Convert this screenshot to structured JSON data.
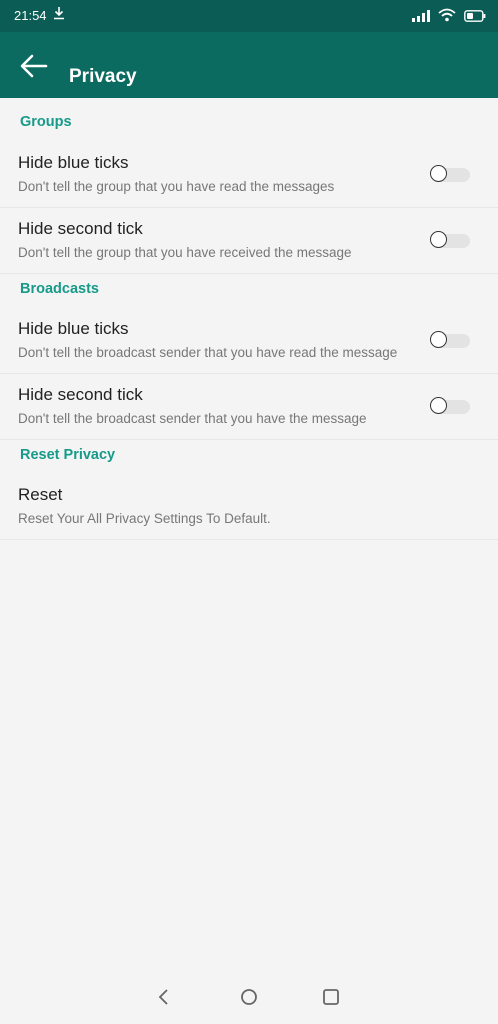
{
  "status": {
    "time": "21:54"
  },
  "appbar": {
    "title": "Privacy"
  },
  "sections": [
    {
      "header": "Groups",
      "items": [
        {
          "title": "Hide blue ticks",
          "subtitle": "Don't tell the group that you have read the messages",
          "toggle_on": false
        },
        {
          "title": "Hide second tick",
          "subtitle": "Don't tell the group that you have received the message",
          "toggle_on": false
        }
      ]
    },
    {
      "header": "Broadcasts",
      "items": [
        {
          "title": "Hide blue ticks",
          "subtitle": "Don't tell the broadcast sender that you have read the message",
          "toggle_on": false
        },
        {
          "title": "Hide second tick",
          "subtitle": "Don't tell the broadcast sender that you have the message",
          "toggle_on": false
        }
      ]
    },
    {
      "header": "Reset Privacy",
      "items": [
        {
          "title": "Reset",
          "subtitle": "Reset Your All Privacy Settings To Default."
        }
      ]
    }
  ],
  "colors": {
    "status_bar": "#0a5c54",
    "app_bar": "#0b6b61",
    "accent": "#179a8a"
  }
}
